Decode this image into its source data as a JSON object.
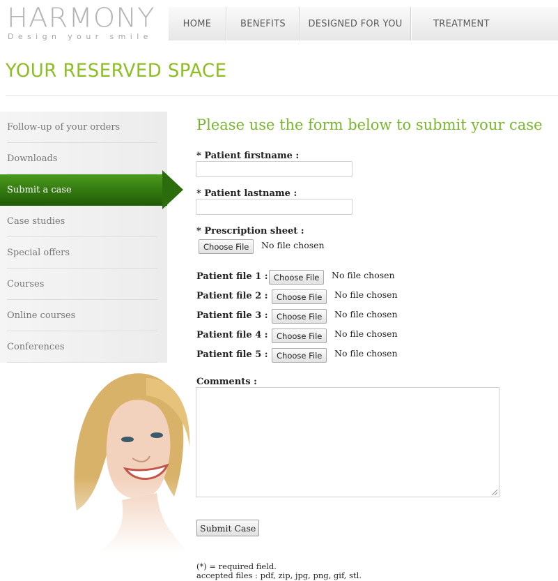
{
  "logo": {
    "word": "HARMONY",
    "tagline": "Design your smile"
  },
  "nav": [
    "HOME",
    "BENEFITS",
    "DESIGNED FOR YOU",
    "TREATMENT"
  ],
  "page_title": "YOUR RESERVED SPACE",
  "sidebar": {
    "items": [
      {
        "label": "Follow-up of your orders"
      },
      {
        "label": "Downloads"
      },
      {
        "label": "Submit a case",
        "active": true
      },
      {
        "label": "Case studies"
      },
      {
        "label": "Special offers"
      },
      {
        "label": "Courses"
      },
      {
        "label": "Online courses"
      },
      {
        "label": "Conferences"
      }
    ],
    "active_color": "#2c6c0c"
  },
  "form": {
    "heading": "Please use the form below to submit your case",
    "firstname_label": "* Patient firstname :",
    "lastname_label": "* Patient lastname :",
    "prescription_label": "* Prescription sheet :",
    "choose_file": "Choose File",
    "no_file": "No file chosen",
    "patient_files": [
      {
        "label": "Patient file 1 :"
      },
      {
        "label": "Patient file 2 :"
      },
      {
        "label": "Patient file 3 :"
      },
      {
        "label": "Patient file 4 :"
      },
      {
        "label": "Patient file 5 :"
      }
    ],
    "comments_label": "Comments :",
    "submit": "Submit Case",
    "required_note": "(*) = required field.",
    "accepted_note": "accepted files : pdf, zip, jpg, png, gif, stl."
  },
  "colors": {
    "accent": "#8cbf21",
    "heading": "#78b62c"
  }
}
